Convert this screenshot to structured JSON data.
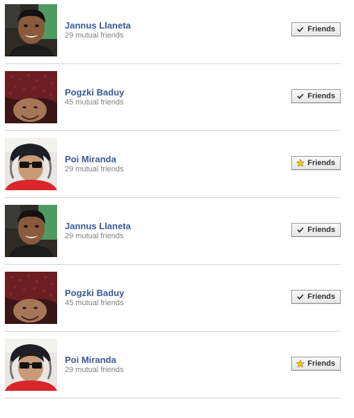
{
  "friends": [
    {
      "name": "Jannus Llaneta",
      "mutual": "29 mutual friends",
      "button_label": "Friends",
      "button_icon": "check-icon",
      "avatar": "green"
    },
    {
      "name": "Pogzki Baduy",
      "mutual": "45 mutual friends",
      "button_label": "Friends",
      "button_icon": "check-icon",
      "avatar": "red"
    },
    {
      "name": "Poi Miranda",
      "mutual": "29 mutual friends",
      "button_label": "Friends",
      "button_icon": "star-icon",
      "avatar": "shades"
    },
    {
      "name": "Jannus Llaneta",
      "mutual": "29 mutual friends",
      "button_label": "Friends",
      "button_icon": "check-icon",
      "avatar": "green"
    },
    {
      "name": "Pogzki Baduy",
      "mutual": "45 mutual friends",
      "button_label": "Friends",
      "button_icon": "check-icon",
      "avatar": "red"
    },
    {
      "name": "Poi Miranda",
      "mutual": "29 mutual friends",
      "button_label": "Friends",
      "button_icon": "star-icon",
      "avatar": "shades"
    }
  ],
  "colors": {
    "link": "#3b5998",
    "muted": "#808080",
    "divider": "#d3d6db",
    "star": "#f5c518"
  }
}
